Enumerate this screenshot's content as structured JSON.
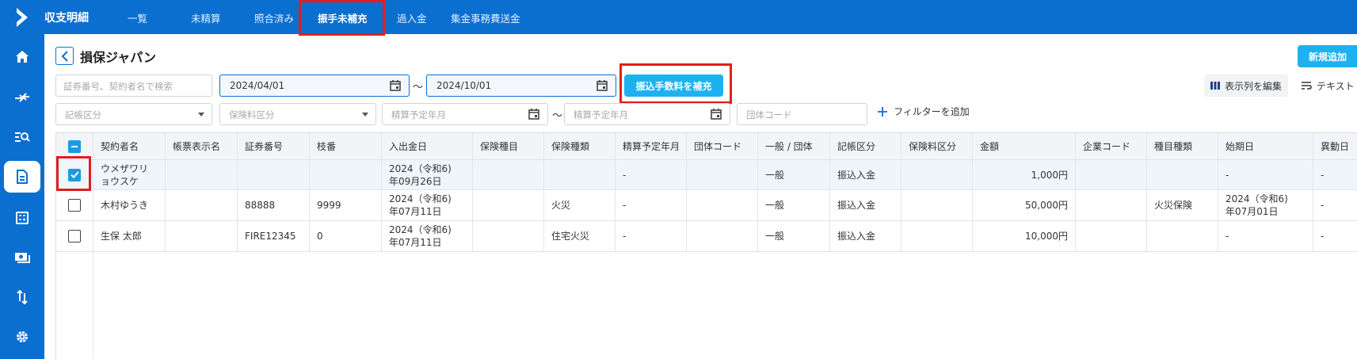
{
  "app": {
    "title": "収支明細"
  },
  "nav": {
    "tabs": [
      {
        "label": "一覧"
      },
      {
        "label": "未精算"
      },
      {
        "label": "照合済み"
      },
      {
        "label": "振手未補充"
      },
      {
        "label": "過入金"
      },
      {
        "label": "集金事務費送金"
      }
    ],
    "active_index": 3
  },
  "page": {
    "title": "損保ジャパン",
    "new_button": "新規追加"
  },
  "filters": {
    "search_placeholder": "証券番号、契約者名で検索",
    "date_from": "2024/04/01",
    "date_to": "2024/10/01",
    "tilde": "〜",
    "supplement_button": "振込手数料を補充",
    "edit_columns": "表示列を編集",
    "text_button": "テキスト",
    "entry_category_placeholder": "記帳区分",
    "premium_category_placeholder": "保険料区分",
    "settle_from_placeholder": "精算予定年月",
    "settle_to_placeholder": "精算予定年月",
    "group_code_placeholder": "団体コード",
    "add_filter": "フィルターを追加"
  },
  "table": {
    "columns": [
      "契約者名",
      "帳票表示名",
      "証券番号",
      "枝番",
      "入出金日",
      "保険種目",
      "保険種類",
      "精算予定年月",
      "団体コード",
      "一般 / 団体",
      "記帳区分",
      "保険料区分",
      "金額",
      "企業コード",
      "種目種類",
      "始期日",
      "異動日"
    ],
    "rows": [
      {
        "checked": true,
        "cells": [
          "ウメザワリ\nョウスケ",
          "",
          "",
          "",
          "2024（令和6)\n年09月26日",
          "",
          "",
          "-",
          "",
          "一般",
          "振込入金",
          "",
          "1,000円",
          "",
          "",
          "-",
          "-"
        ]
      },
      {
        "checked": false,
        "cells": [
          "木村ゆうき",
          "",
          "88888",
          "9999",
          "2024（令和6)\n年07月11日",
          "",
          "火災",
          "-",
          "",
          "一般",
          "振込入金",
          "",
          "50,000円",
          "",
          "火災保険",
          "2024（令和6)\n年07月01日",
          "-"
        ]
      },
      {
        "checked": false,
        "cells": [
          "生保 太郎",
          "",
          "FIRE12345",
          "0",
          "2024（令和6)\n年07月11日",
          "",
          "住宅火災",
          "-",
          "",
          "一般",
          "振込入金",
          "",
          "10,000円",
          "",
          "",
          "-",
          "-"
        ]
      }
    ]
  },
  "icons": {
    "sidebar": [
      "home-icon",
      "transfer-icon",
      "search-list-icon",
      "document-icon",
      "calculator-icon",
      "money-icon",
      "sort-icon",
      "gear-icon"
    ]
  },
  "colors": {
    "brand": "#0b6fd0",
    "accent": "#1db1f0",
    "highlight": "#e01e1e"
  }
}
